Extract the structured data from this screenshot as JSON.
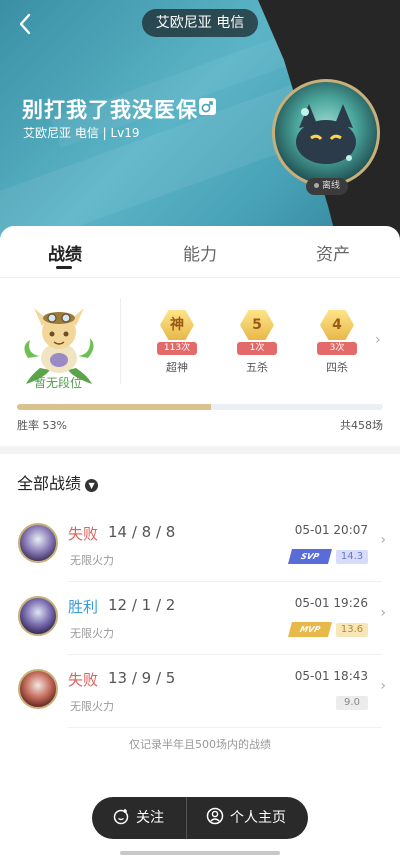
{
  "header": {
    "server_pill": "艾欧尼亚 电信",
    "nickname": "别打我了我没医保",
    "subtitle": "艾欧尼亚 电信 | Lv19",
    "status": "离线",
    "gender_icon": "male-icon"
  },
  "tabs": [
    {
      "label": "战绩",
      "active": true
    },
    {
      "label": "能力",
      "active": false
    },
    {
      "label": "资产",
      "active": false
    }
  ],
  "rank": {
    "label": "暂无段位"
  },
  "badges": [
    {
      "glyph": "神",
      "count": "113次",
      "name": "超神"
    },
    {
      "glyph": "5",
      "count": "1次",
      "name": "五杀"
    },
    {
      "glyph": "4",
      "count": "3次",
      "name": "四杀"
    }
  ],
  "stats": {
    "win_rate_label": "胜率  53%",
    "win_rate": 0.53,
    "total": "共458场"
  },
  "section": {
    "title": "全部战绩"
  },
  "matches": [
    {
      "result": "失败",
      "kda": "14 / 8 / 8",
      "mode": "无限火力",
      "time": "05-01 20:07",
      "medal": "SVP",
      "score": "14.3"
    },
    {
      "result": "胜利",
      "kda": "12 / 1 / 2",
      "mode": "无限火力",
      "time": "05-01 19:26",
      "medal": "MVP",
      "score": "13.6"
    },
    {
      "result": "失败",
      "kda": "13 / 9 / 5",
      "mode": "无限火力",
      "time": "05-01 18:43",
      "medal": "",
      "score": "9.0"
    }
  ],
  "note": "仅记录半年且500场内的战绩",
  "actions": {
    "follow": "关注",
    "profile": "个人主页"
  },
  "colors": {
    "lose": "#e0605a",
    "win": "#3a9bd8",
    "accent_gold": "#c9b07a"
  }
}
